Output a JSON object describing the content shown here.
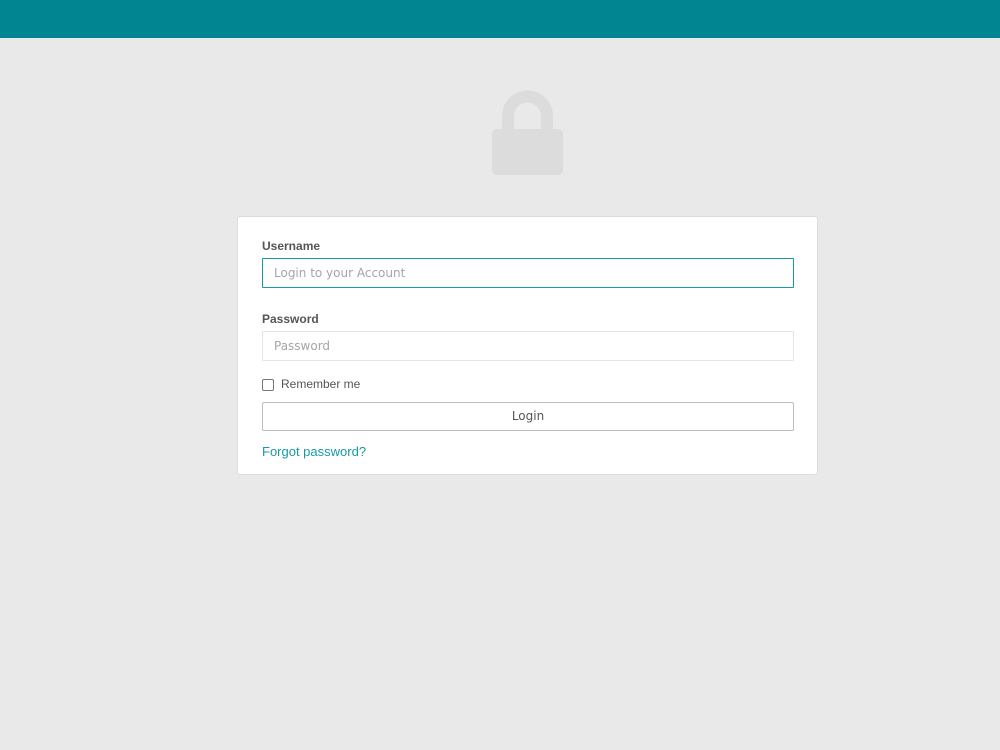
{
  "colors": {
    "header": "#008591",
    "accent": "#179aa5",
    "background": "#e9e9e9",
    "lock_icon": "#dcdcdc"
  },
  "header": {
    "icon": "lock-icon"
  },
  "form": {
    "username_label": "Username",
    "username_placeholder": "Login to your Account",
    "username_value": "",
    "password_label": "Password",
    "password_placeholder": "Password",
    "password_value": "",
    "remember_label": "Remember me",
    "remember_checked": false,
    "login_label": "Login",
    "forgot_label": "Forgot password?"
  }
}
